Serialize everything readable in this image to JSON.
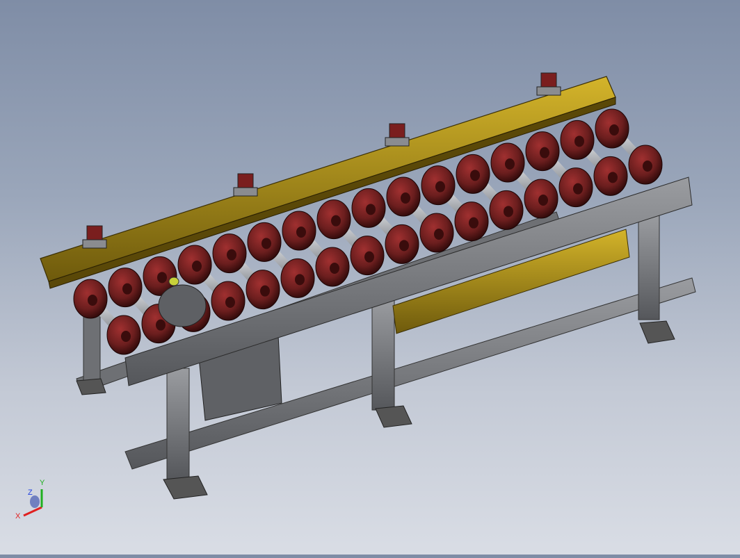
{
  "viewport": {
    "background_top": "#7f8da6",
    "background_bottom": "#d9dde5"
  },
  "model": {
    "roller_count": 16,
    "frame_color": "#7a7c80",
    "roller_color": "#6b1e1e",
    "beam_color": "#b89a1e",
    "shaft_color": "#b8bcc2"
  },
  "triad": {
    "x_label": "X",
    "y_label": "Y",
    "z_label": "Z",
    "x_color": "#e02020",
    "y_color": "#20b020",
    "z_color": "#2040e0"
  }
}
